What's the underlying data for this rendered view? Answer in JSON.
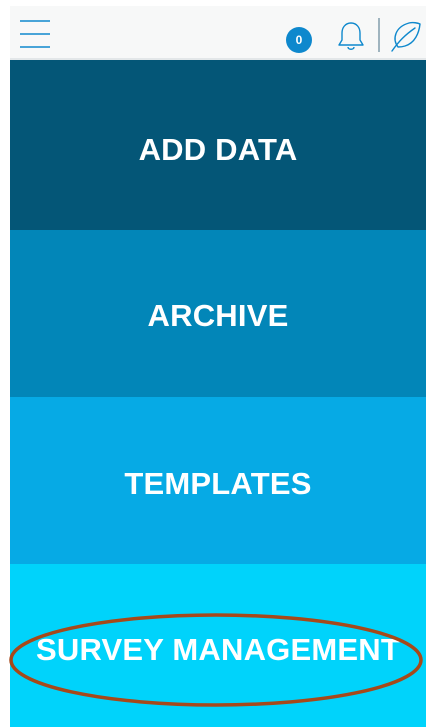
{
  "header": {
    "notification_count": "0",
    "icons": [
      "menu-icon",
      "bell-icon",
      "leaf-icon"
    ]
  },
  "tiles": [
    {
      "label": "ADD DATA",
      "color": "#045677"
    },
    {
      "label": "ARCHIVE",
      "color": "#0286b8"
    },
    {
      "label": "TEMPLATES",
      "color": "#06aae5"
    },
    {
      "label": "SURVEY MANAGEMENT",
      "color": "#00d3fb"
    }
  ],
  "colors": {
    "badge": "#0e88cd",
    "highlight_ring": "#a6491a",
    "header_bg": "#f7f8f8"
  }
}
